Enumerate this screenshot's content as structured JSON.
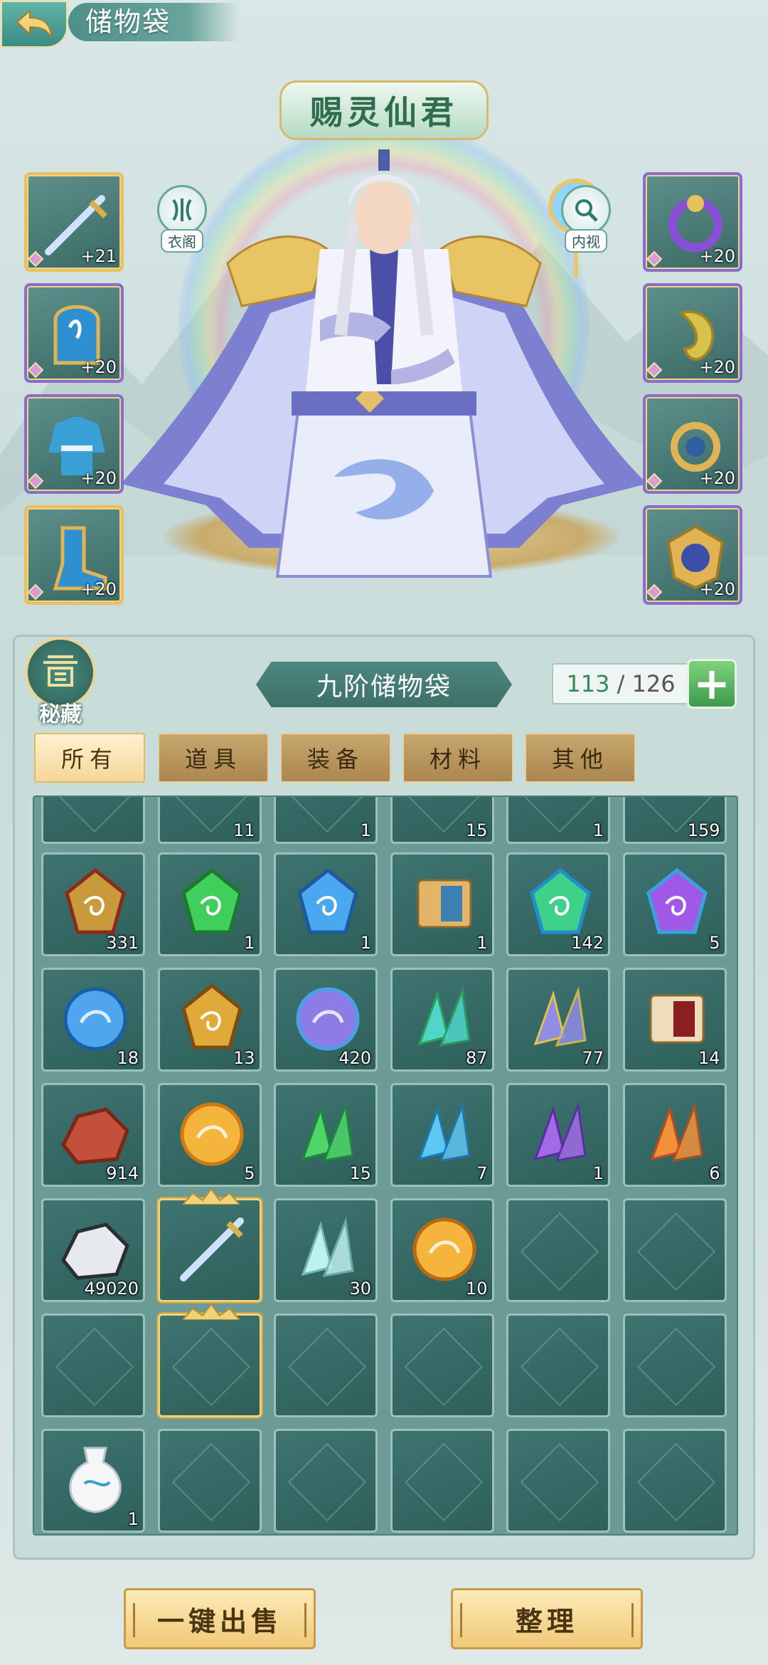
{
  "header": {
    "title": "储物袋"
  },
  "character": {
    "name": "赐灵仙君"
  },
  "side_buttons": {
    "wardrobe": "衣阁",
    "inspect": "内视"
  },
  "equipment": {
    "left": [
      {
        "icon": "sword-icon",
        "level": "+21"
      },
      {
        "icon": "helmet-icon",
        "level": "+20"
      },
      {
        "icon": "robe-icon",
        "level": "+20"
      },
      {
        "icon": "boots-icon",
        "level": "+20"
      }
    ],
    "right": [
      {
        "icon": "bracelet-icon",
        "level": "+20"
      },
      {
        "icon": "jade-pendant-icon",
        "level": "+20"
      },
      {
        "icon": "ring-icon",
        "level": "+20"
      },
      {
        "icon": "talisman-badge-icon",
        "level": "+20"
      }
    ]
  },
  "bag": {
    "secret_label": "秘藏",
    "title": "九阶储物袋",
    "used": "113",
    "separator": " / ",
    "total": "126",
    "add_label": "+"
  },
  "tabs": [
    "所有",
    "道具",
    "装备",
    "材料",
    "其他"
  ],
  "partial_row": [
    "",
    "11",
    "1",
    "15",
    "1",
    "159"
  ],
  "items": [
    [
      {
        "icon": "attack-badge-icon",
        "qty": "331"
      },
      {
        "icon": "green-spirit-crystal-icon",
        "qty": "1"
      },
      {
        "icon": "blue-spirit-crystal-icon",
        "qty": "1"
      },
      {
        "icon": "scroll-book-icon",
        "qty": "1"
      },
      {
        "icon": "green-cloud-gem-icon",
        "qty": "142"
      },
      {
        "icon": "purple-cloud-gem-icon",
        "qty": "5"
      }
    ],
    [
      {
        "icon": "blue-swirl-orb-icon",
        "qty": "18"
      },
      {
        "icon": "golden-armor-piece-icon",
        "qty": "13"
      },
      {
        "icon": "dragon-stone-icon",
        "qty": "420"
      },
      {
        "icon": "teal-crystal-cluster-icon",
        "qty": "87"
      },
      {
        "icon": "violet-crystal-cluster-icon",
        "qty": "77"
      },
      {
        "icon": "rolled-scroll-icon",
        "qty": "14"
      }
    ],
    [
      {
        "icon": "red-ore-icon",
        "qty": "914"
      },
      {
        "icon": "golden-orb-icon",
        "qty": "5"
      },
      {
        "icon": "green-shard-icon",
        "qty": "15"
      },
      {
        "icon": "blue-shard-icon",
        "qty": "7"
      },
      {
        "icon": "purple-shard-icon",
        "qty": "1"
      },
      {
        "icon": "orange-shard-icon",
        "qty": "6"
      }
    ],
    [
      {
        "icon": "silver-ore-icon",
        "qty": "49020"
      },
      {
        "icon": "sword-icon",
        "qty": ""
      },
      {
        "icon": "ice-crystal-icon",
        "qty": "30"
      },
      {
        "icon": "golden-dragon-orb-icon",
        "qty": "10"
      },
      {
        "icon": "",
        "qty": ""
      },
      {
        "icon": "",
        "qty": ""
      }
    ],
    [
      {
        "icon": "",
        "qty": ""
      },
      {
        "icon": "",
        "qty": ""
      },
      {
        "icon": "",
        "qty": ""
      },
      {
        "icon": "",
        "qty": ""
      },
      {
        "icon": "",
        "qty": ""
      },
      {
        "icon": "",
        "qty": ""
      }
    ],
    [
      {
        "icon": "porcelain-vase-icon",
        "qty": "1"
      },
      {
        "icon": "",
        "qty": ""
      },
      {
        "icon": "",
        "qty": ""
      },
      {
        "icon": "",
        "qty": ""
      },
      {
        "icon": "",
        "qty": ""
      },
      {
        "icon": "",
        "qty": ""
      }
    ]
  ],
  "actions": {
    "sell_all": "一键出售",
    "sort": "整理"
  },
  "colors": {
    "accent": "#3d7068",
    "tab_active": "#f4d79a",
    "tab_inactive": "#c8a76e",
    "plus_button": "#3d9a4d"
  }
}
